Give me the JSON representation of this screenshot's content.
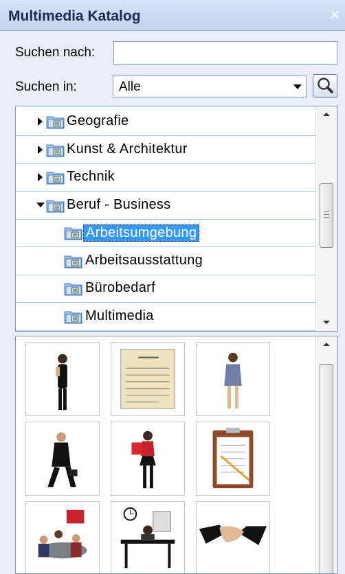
{
  "window": {
    "title": "Multimedia Katalog",
    "close_symbol": "×"
  },
  "search": {
    "label": "Suchen nach:",
    "value": "",
    "placeholder": ""
  },
  "scope": {
    "label": "Suchen in:",
    "selected": "Alle",
    "icon": "chevron-down-icon"
  },
  "search_button": {
    "icon": "magnifier-icon"
  },
  "tree": {
    "items": [
      {
        "label": "Geografie",
        "state": "collapsed",
        "level": 1
      },
      {
        "label": "Kunst & Architektur",
        "state": "collapsed",
        "level": 1
      },
      {
        "label": "Technik",
        "state": "collapsed",
        "level": 1
      },
      {
        "label": "Beruf - Business",
        "state": "expanded",
        "level": 1
      },
      {
        "label": "Arbeitsumgebung",
        "state": "leaf",
        "level": 2,
        "selected": true
      },
      {
        "label": "Arbeitsausstattung",
        "state": "leaf",
        "level": 2
      },
      {
        "label": "Bürobedarf",
        "state": "leaf",
        "level": 2
      },
      {
        "label": "Multimedia",
        "state": "leaf",
        "level": 2
      }
    ],
    "selection_color": "#3399ff"
  },
  "gallery": {
    "items": [
      {
        "icon": "businesswoman-phone-icon"
      },
      {
        "icon": "document-form-icon"
      },
      {
        "icon": "businesswoman-walking-icon"
      },
      {
        "icon": "businessman-briefcase-icon"
      },
      {
        "icon": "woman-red-folder-icon"
      },
      {
        "icon": "clipboard-checklist-icon"
      },
      {
        "icon": "meeting-presentation-icon"
      },
      {
        "icon": "office-desk-clock-icon"
      },
      {
        "icon": "handshake-icon"
      }
    ]
  }
}
